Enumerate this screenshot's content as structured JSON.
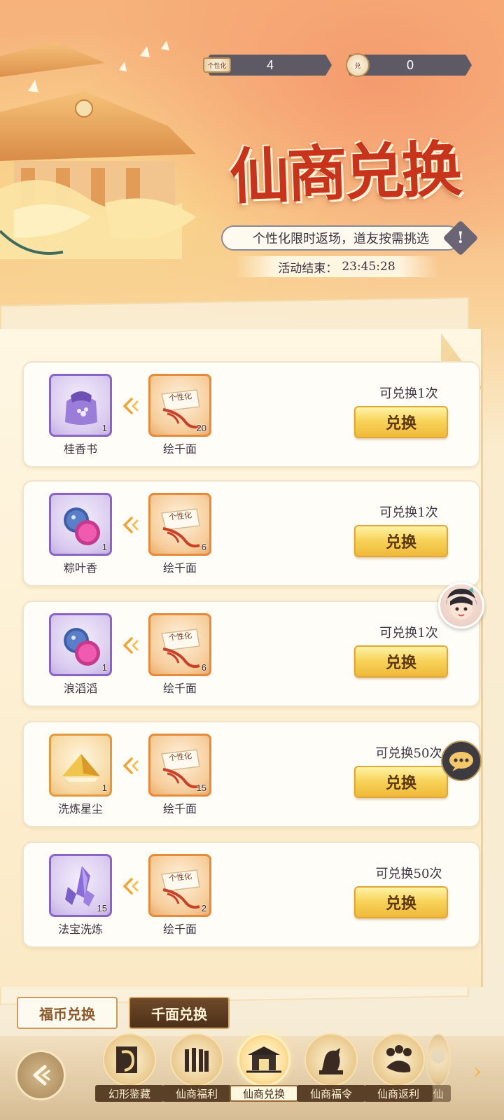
{
  "currency": [
    {
      "icon_label": "个性化",
      "value": "4"
    },
    {
      "icon_label": "兑",
      "value": "0"
    }
  ],
  "header": {
    "title": "仙商兑换",
    "subtitle": "个性化限时返场，道友按需挑选",
    "notice_symbol": "!",
    "timer_label": "活动结束：",
    "timer_value": "23:45:28"
  },
  "exchange_items": [
    {
      "reward_name": "桂香书",
      "reward_count": "1",
      "reward_rarity": "purple",
      "cost_name": "绘千面",
      "cost_count": "20",
      "limit": "可兑换1次",
      "button": "兑换"
    },
    {
      "reward_name": "粽叶香",
      "reward_count": "1",
      "reward_rarity": "purple",
      "cost_name": "绘千面",
      "cost_count": "6",
      "limit": "可兑换1次",
      "button": "兑换"
    },
    {
      "reward_name": "浪滔滔",
      "reward_count": "1",
      "reward_rarity": "purple",
      "cost_name": "绘千面",
      "cost_count": "6",
      "limit": "可兑换1次",
      "button": "兑换"
    },
    {
      "reward_name": "洗炼星尘",
      "reward_count": "1",
      "reward_rarity": "gold",
      "cost_name": "绘千面",
      "cost_count": "15",
      "limit": "可兑换50次",
      "button": "兑换"
    },
    {
      "reward_name": "法宝洗炼",
      "reward_count": "15",
      "reward_rarity": "purple",
      "cost_name": "绘千面",
      "cost_count": "2",
      "limit": "可兑换50次",
      "button": "兑换"
    }
  ],
  "scroll_icon_text": "个性化",
  "tabs": [
    {
      "label": "福币兑换",
      "active": false
    },
    {
      "label": "千面兑换",
      "active": true
    }
  ],
  "bottom_nav": [
    {
      "label": "幻形鉴藏",
      "icon": "dragon-icon",
      "active": false
    },
    {
      "label": "仙商福利",
      "icon": "scroll-bundle-icon",
      "active": false
    },
    {
      "label": "仙商兑换",
      "icon": "pavilion-icon",
      "active": true
    },
    {
      "label": "仙商福令",
      "icon": "horse-statue-icon",
      "active": false
    },
    {
      "label": "仙商返利",
      "icon": "coin-dragon-icon",
      "active": false
    },
    {
      "label": "仙",
      "icon": "partial-icon",
      "active": false
    }
  ],
  "colors": {
    "title_red": "#c8331b",
    "button_gold": "#f8d45c",
    "rarity_purple": "#8c64c6",
    "rarity_orange": "#e68a3b",
    "tab_active_bg": "#5b3a1f"
  }
}
